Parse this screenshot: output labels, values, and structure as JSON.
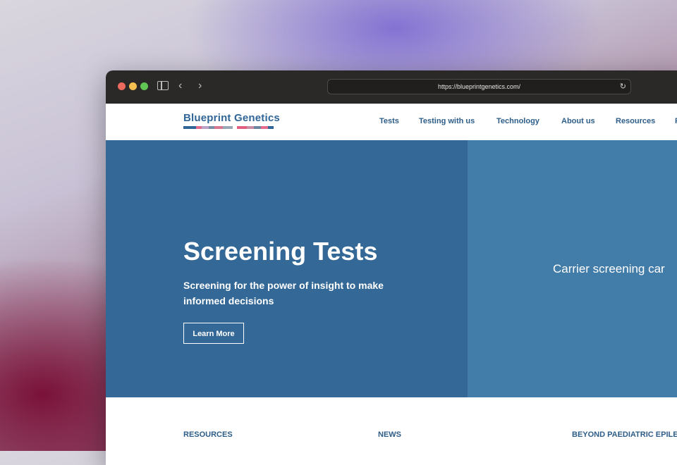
{
  "browser": {
    "url": "https://blueprintgenetics.com/"
  },
  "site": {
    "logo_text": "Blueprint Genetics",
    "brand_color": "#2f6597",
    "nav": [
      {
        "label": "Tests"
      },
      {
        "label": "Testing with us"
      },
      {
        "label": "Technology"
      },
      {
        "label": "About us"
      },
      {
        "label": "Resources"
      },
      {
        "label": "F"
      }
    ]
  },
  "hero": {
    "title": "Screening Tests",
    "subtitle": "Screening for the power of insight to make informed decisions",
    "button_label": "Learn More",
    "right_panel_text": "Carrier screening car",
    "left_color": "#346896",
    "right_color": "#427ca8"
  },
  "lower_links": [
    {
      "label": "RESOURCES"
    },
    {
      "label": "NEWS"
    },
    {
      "label": "BEYOND PAEDIATRIC EPILE"
    }
  ]
}
